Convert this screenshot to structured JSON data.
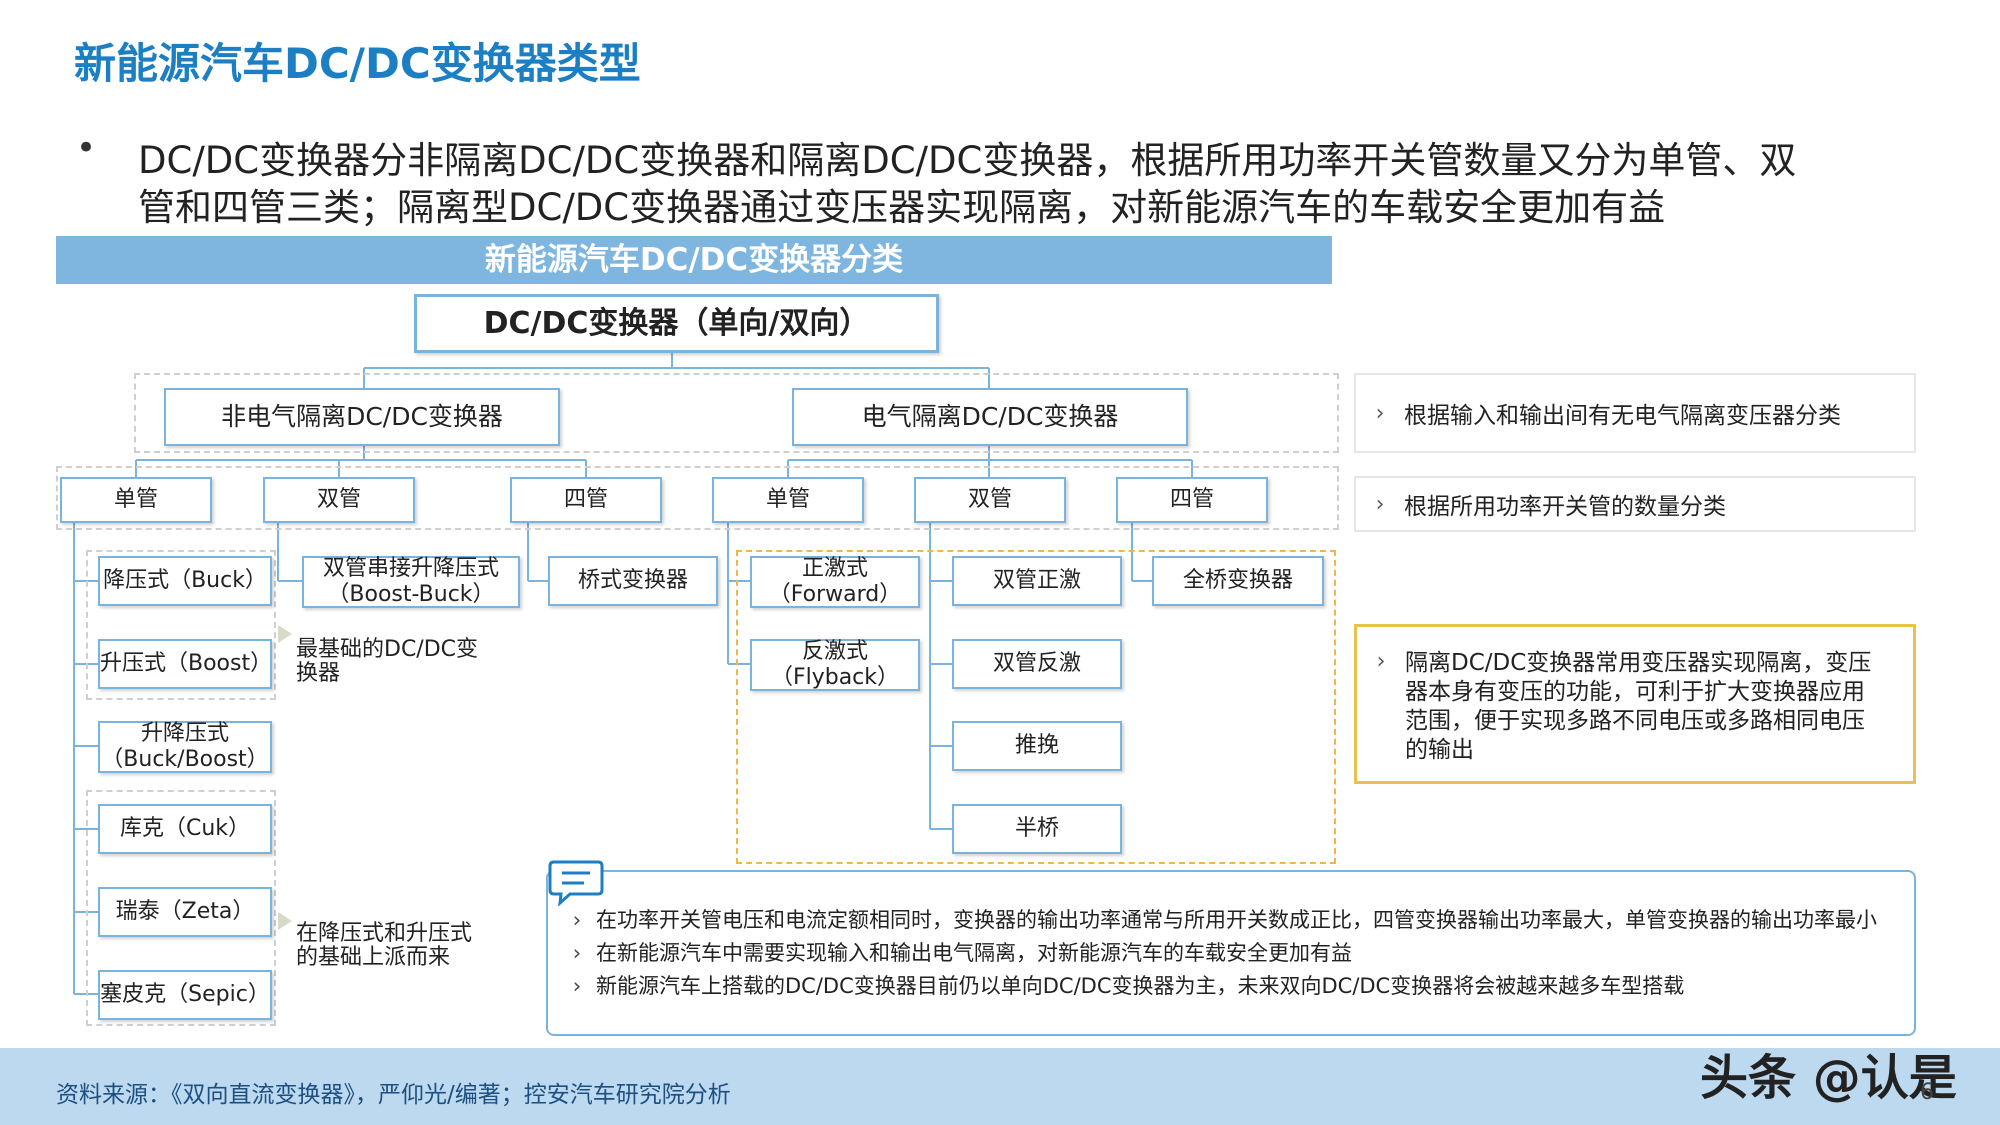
{
  "title": "新能源汽车DC/DC变换器类型",
  "bullet": {
    "line1": "DC/DC变换器分非隔离DC/DC变换器和隔离DC/DC变换器，根据所用功率开关管数量又分为单管、双",
    "line2": "管和四管三类；隔离型DC/DC变换器通过变压器实现隔离，对新能源汽车的车载安全更加有益"
  },
  "banner": "新能源汽车DC/DC变换器分类",
  "tree": {
    "root": "DC/DC变换器（单向/双向）",
    "non_isolated": "非电气隔离DC/DC变换器",
    "isolated": "电气隔离DC/DC变换器",
    "ni_single": "单管",
    "ni_double": "双管",
    "ni_quad": "四管",
    "i_single": "单管",
    "i_double": "双管",
    "i_quad": "四管",
    "buck": "降压式（Buck）",
    "boost": "升压式（Boost）",
    "buckboost_l1": "升降压式",
    "buckboost_l2": "（Buck/Boost）",
    "cuk": "库克（Cuk）",
    "zeta": "瑞泰（Zeta）",
    "sepic": "塞皮克（Sepic）",
    "dual_l1": "双管串接升降压式",
    "dual_l2": "（Boost-Buck）",
    "bridge": "桥式变换器",
    "forward_l1": "正激式",
    "forward_l2": "（Forward）",
    "flyback_l1": "反激式",
    "flyback_l2": "（Flyback）",
    "dual_forward": "双管正激",
    "dual_flyback": "双管反激",
    "push_pull": "推挽",
    "half_bridge": "半桥",
    "full_bridge": "全桥变换器"
  },
  "notes": {
    "basic": "最基础的DC/DC变换器",
    "derived": "在降压式和升压式的基础上派而来"
  },
  "side_panels": {
    "p1": "根据输入和输出间有无电气隔离变压器分类",
    "p2": "根据所用功率开关管的数量分类",
    "p3": "隔离DC/DC变换器常用变压器实现隔离，变压器本身有变压的功能，可利于扩大变换器应用范围，便于实现多路不同电压或多路相同电压的输出"
  },
  "comments": [
    "在功率开关管电压和电流定额相同时，变换器的输出功率通常与所用开关数成正比，四管变换器输出功率最大，单管变换器的输出功率最小",
    "在新能源汽车中需要实现输入和输出电气隔离，对新能源汽车的车载安全更加有益",
    "新能源汽车上搭载的DC/DC变换器目前仍以单向DC/DC变换器为主，未来双向DC/DC变换器将会被越来越多车型搭载"
  ],
  "chevron": "›",
  "source": "资料来源：《双向直流变换器》，严仰光/编著；控安汽车研究院分析",
  "watermark": "头条 @认是",
  "page_number": "6",
  "colors": {
    "title": "#1c7fc3",
    "box_border": "#7ab3dc",
    "banner": "#7fb6e0",
    "footer": "#bcd9ef",
    "orange_dash": "#f2b54a",
    "gold": "#e8c24c"
  }
}
